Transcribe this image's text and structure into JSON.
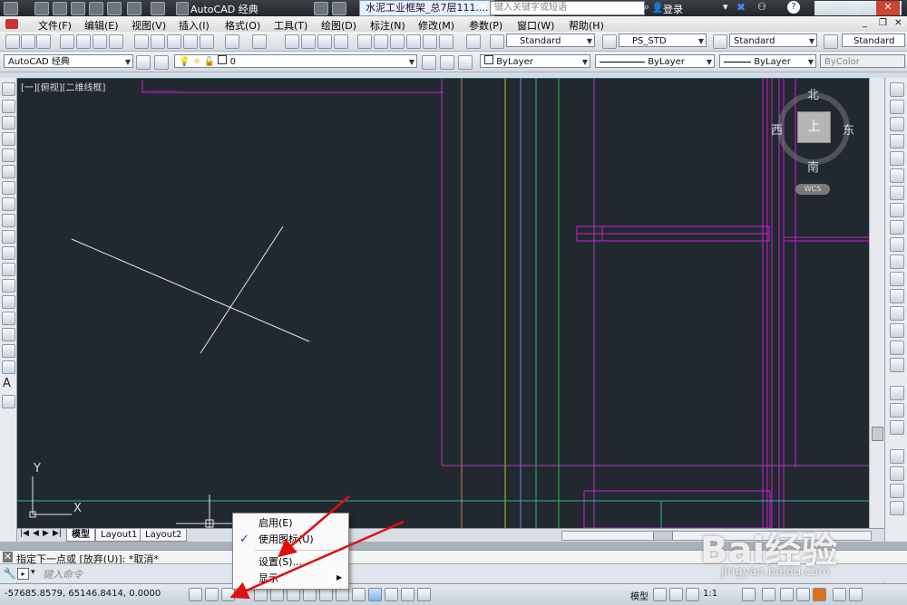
{
  "titlebar": {
    "workspace": "AutoCAD 经典",
    "document": "水泥工业框架_总7层111....",
    "search_placeholder": "键入关键字或短语",
    "login": "登录"
  },
  "menu": [
    "文件(F)",
    "编辑(E)",
    "视图(V)",
    "插入(I)",
    "格式(O)",
    "工具(T)",
    "绘图(D)",
    "标注(N)",
    "修改(M)",
    "参数(P)",
    "窗口(W)",
    "帮助(H)"
  ],
  "styles": {
    "text_style": "Standard",
    "dim_style": "PS_STD",
    "table_style": "Standard",
    "mleader_style": "Standard"
  },
  "layers": {
    "workspace_combo": "AutoCAD 经典",
    "current_layer": "0",
    "color": "ByLayer",
    "linetype": "ByLayer",
    "lineweight": "ByLayer",
    "plotstyle": "ByColor"
  },
  "canvas": {
    "viewport_label": "[一][俯视][二维线框]",
    "viewcube": {
      "north": "北",
      "south": "南",
      "east": "东",
      "west": "西",
      "top": "上",
      "wcs": "WCS"
    },
    "ucs_y": "Y",
    "ucs_x": "X"
  },
  "tabs": [
    "模型",
    "Layout1",
    "Layout2"
  ],
  "command": {
    "history": "指定下一点或 [放弃(U)]: *取消*",
    "prompt": "键入命令"
  },
  "status": {
    "coords": "-57685.8579, 65146.8414, 0.0000",
    "model_label": "模型",
    "scale": "1:1"
  },
  "context_menu": {
    "items": [
      "启用(E)",
      "使用图标(U)",
      "设置(S)...",
      "显示"
    ],
    "checked": "使用图标(U)"
  },
  "watermark": {
    "brand": "Bai经验",
    "url": "jingyan.baidu.com"
  },
  "colors": {
    "canvas_bg": "#212830",
    "magenta": "#d020d0",
    "green": "#20c040",
    "cyan": "#30b0a0",
    "arrow_red": "#e01010"
  }
}
